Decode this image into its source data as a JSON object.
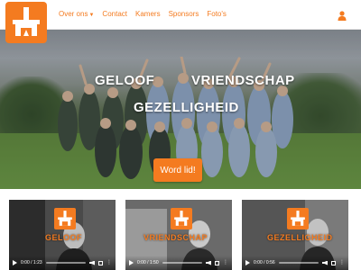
{
  "navbar": {
    "logo_icon": "fireplace-logo-icon",
    "links": [
      "Over ons",
      "Contact",
      "Kamers",
      "Sponsors",
      "Foto's"
    ],
    "user_icon": "user-icon"
  },
  "hero": {
    "words": [
      "GELOOF",
      "VRIENDSCHAP",
      "GEZELLIGHEID"
    ],
    "cta_label": "Word lid!"
  },
  "videos": [
    {
      "title": "GELOOF",
      "time": "0:00 / 1:23"
    },
    {
      "title": "VRIENDSCHAP",
      "time": "0:00 / 1:50"
    },
    {
      "title": "GEZELLIGHEID",
      "time": "0:00 / 0:56"
    }
  ],
  "colors": {
    "accent": "#f47b20"
  }
}
